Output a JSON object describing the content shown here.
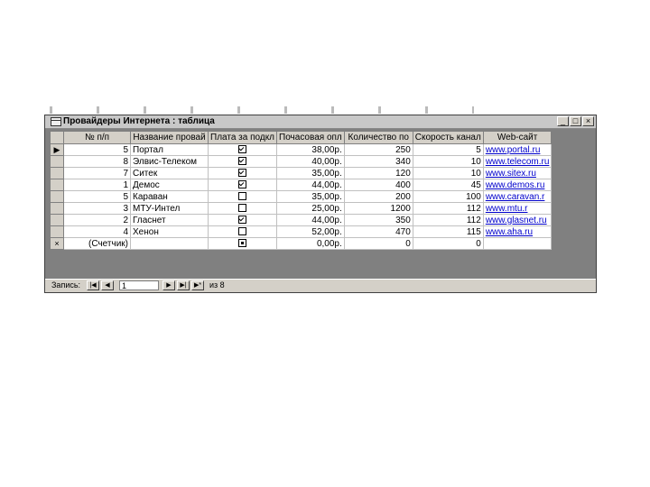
{
  "window": {
    "title": "Провайдеры Интернета : таблица",
    "minimize_glyph": "_",
    "maximize_glyph": "□",
    "close_glyph": "×"
  },
  "table": {
    "columns": [
      "№ п/п",
      "Название провай",
      "Плата за подкл",
      "Почасовая опл",
      "Количество по",
      "Скорость канал",
      "Web-сайт"
    ],
    "rows": [
      {
        "marker": "▶",
        "id": "5",
        "name": "Портал",
        "fee": "checked",
        "hourly": "38,00р.",
        "count": "250",
        "speed": "5",
        "site": "www.portal.ru"
      },
      {
        "marker": "",
        "id": "8",
        "name": "Элвис-Телеком",
        "fee": "checked",
        "hourly": "40,00р.",
        "count": "340",
        "speed": "10",
        "site": "www.telecom.ru"
      },
      {
        "marker": "",
        "id": "7",
        "name": "Ситек",
        "fee": "checked",
        "hourly": "35,00р.",
        "count": "120",
        "speed": "10",
        "site": "www.sitex.ru"
      },
      {
        "marker": "",
        "id": "1",
        "name": "Демос",
        "fee": "checked",
        "hourly": "44,00р.",
        "count": "400",
        "speed": "45",
        "site": "www.demos.ru"
      },
      {
        "marker": "",
        "id": "5",
        "name": "Караван",
        "fee": "unchecked",
        "hourly": "35,00р.",
        "count": "200",
        "speed": "100",
        "site": "www.caravan.r"
      },
      {
        "marker": "",
        "id": "3",
        "name": "МТУ-Интел",
        "fee": "unchecked",
        "hourly": "25,00р.",
        "count": "1200",
        "speed": "112",
        "site": "www.mtu.r"
      },
      {
        "marker": "",
        "id": "2",
        "name": "Гласнет",
        "fee": "checked",
        "hourly": "44,00р.",
        "count": "350",
        "speed": "112",
        "site": "www.glasnet.ru"
      },
      {
        "marker": "",
        "id": "4",
        "name": "Хенон",
        "fee": "unchecked",
        "hourly": "52,00р.",
        "count": "470",
        "speed": "115",
        "site": "www.aha.ru"
      },
      {
        "marker": "×",
        "id": "(Счетчик)",
        "name": "",
        "fee": "mixed",
        "hourly": "0,00р.",
        "count": "0",
        "speed": "0",
        "site": ""
      }
    ]
  },
  "navigation": {
    "label": "Запись:",
    "first": "|◀",
    "prev": "◀",
    "record_value": "1",
    "next": "▶",
    "last": "▶|",
    "new": "▶*",
    "of_text": "из 8"
  }
}
